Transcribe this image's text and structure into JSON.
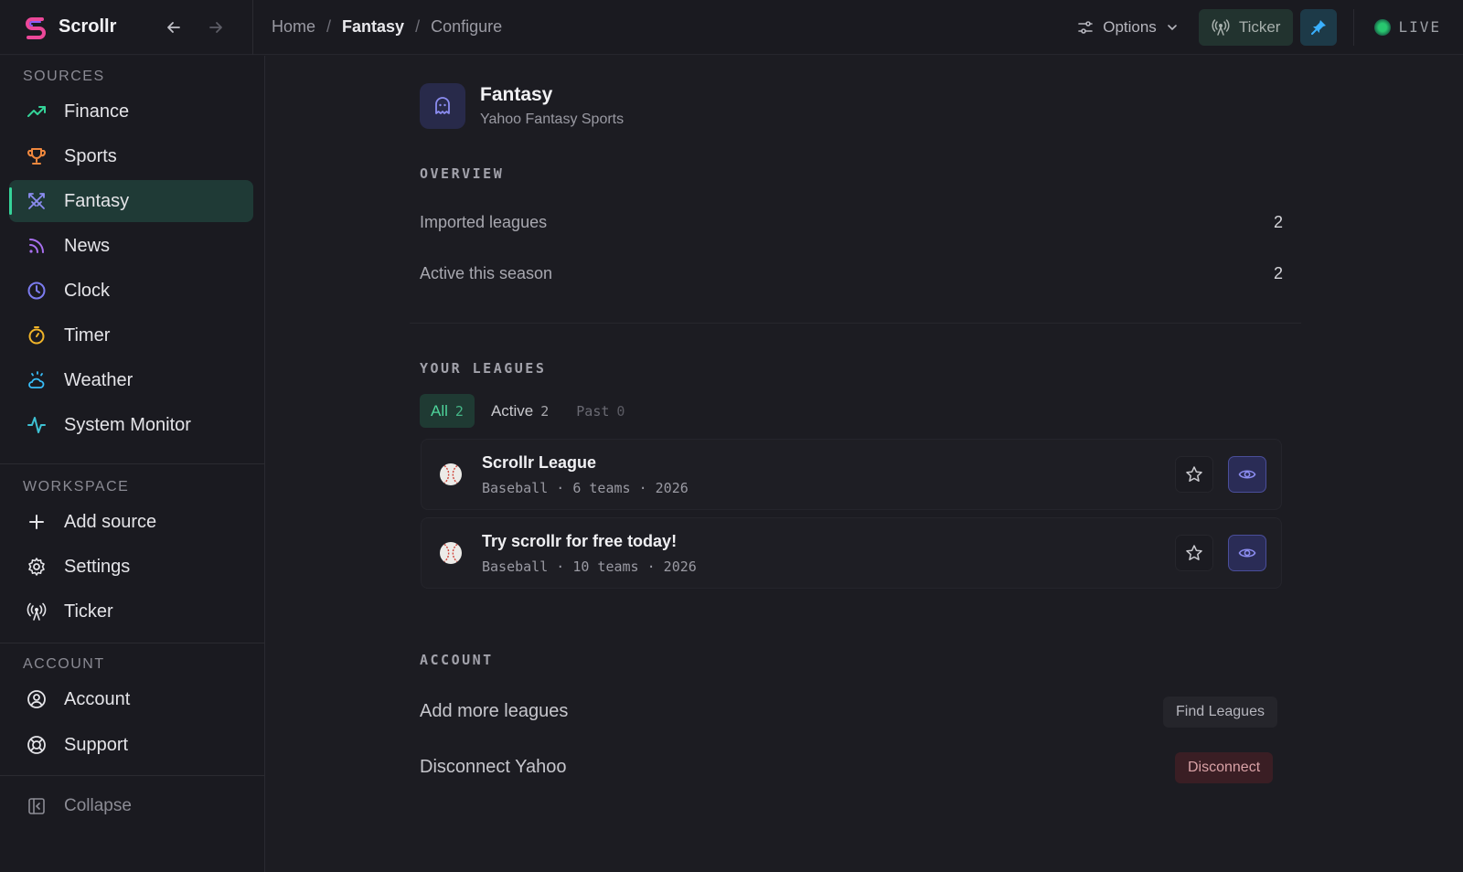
{
  "app": {
    "name": "Scrollr"
  },
  "breadcrumb": {
    "home": "Home",
    "section": "Fantasy",
    "page": "Configure",
    "sep": "/"
  },
  "topbar": {
    "options_label": "Options",
    "ticker_label": "Ticker",
    "live_label": "LIVE"
  },
  "sidebar": {
    "sources_title": "SOURCES",
    "sources": [
      {
        "label": "Finance",
        "icon": "trending-up-icon",
        "color": "#34d399"
      },
      {
        "label": "Sports",
        "icon": "trophy-icon",
        "color": "#f0883e"
      },
      {
        "label": "Fantasy",
        "icon": "swords-icon",
        "color": "#8b8cf0"
      },
      {
        "label": "News",
        "icon": "rss-icon",
        "color": "#a970f0"
      },
      {
        "label": "Clock",
        "icon": "clock-icon",
        "color": "#7c7cf0"
      },
      {
        "label": "Timer",
        "icon": "timer-icon",
        "color": "#f0b429"
      },
      {
        "label": "Weather",
        "icon": "cloud-sun-icon",
        "color": "#38bdf8"
      },
      {
        "label": "System Monitor",
        "icon": "activity-icon",
        "color": "#3ec1d3"
      }
    ],
    "workspace_title": "WORKSPACE",
    "workspace": [
      {
        "label": "Add source",
        "icon": "plus-icon"
      },
      {
        "label": "Settings",
        "icon": "gear-icon"
      },
      {
        "label": "Ticker",
        "icon": "broadcast-icon"
      }
    ],
    "account_title": "ACCOUNT",
    "account": [
      {
        "label": "Account",
        "icon": "user-circle-icon"
      },
      {
        "label": "Support",
        "icon": "lifebuoy-icon"
      }
    ],
    "collapse_label": "Collapse"
  },
  "header": {
    "title": "Fantasy",
    "subtitle": "Yahoo Fantasy Sports"
  },
  "overview": {
    "title": "OVERVIEW",
    "rows": [
      {
        "label": "Imported leagues",
        "value": "2"
      },
      {
        "label": "Active this season",
        "value": "2"
      }
    ]
  },
  "leagues": {
    "title": "YOUR LEAGUES",
    "tabs": [
      {
        "label": "All",
        "count": "2"
      },
      {
        "label": "Active",
        "count": "2"
      },
      {
        "label": "Past",
        "count": "0"
      }
    ],
    "items": [
      {
        "name": "Scrollr League",
        "meta": "Baseball · 6 teams · 2026"
      },
      {
        "name": "Try scrollr for free today!",
        "meta": "Baseball · 10 teams · 2026"
      }
    ]
  },
  "account": {
    "title": "ACCOUNT",
    "add_label": "Add more leagues",
    "find_button": "Find Leagues",
    "disconnect_label": "Disconnect Yahoo",
    "disconnect_button": "Disconnect"
  }
}
